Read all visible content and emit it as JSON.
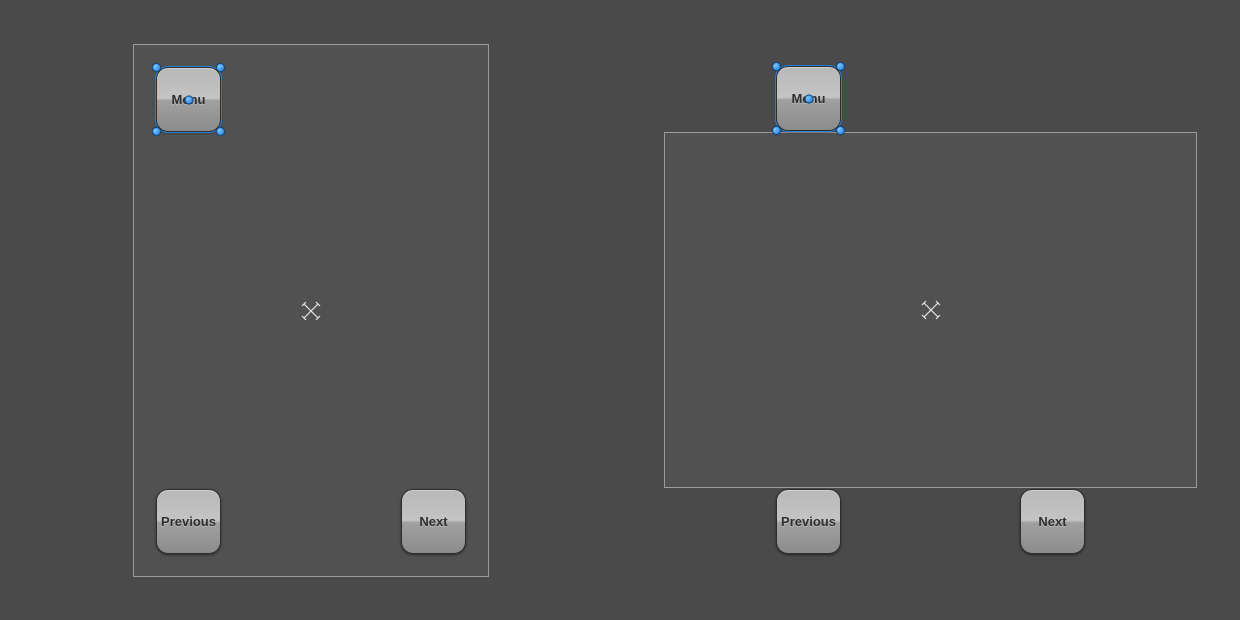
{
  "colors": {
    "background": "#4a4a4a",
    "scene_fill": "#515151",
    "scene_border": "#9a9a9a",
    "selection_handle": "#1e78d6"
  },
  "portrait": {
    "menu_label": "Menu",
    "previous_label": "Previous",
    "next_label": "Next"
  },
  "landscape": {
    "menu_label": "Menu",
    "previous_label": "Previous",
    "next_label": "Next"
  }
}
